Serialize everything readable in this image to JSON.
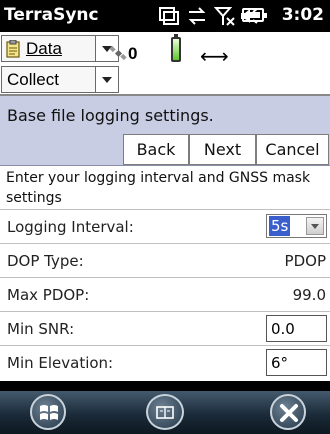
{
  "status_bar": {
    "app_title": "TerraSync",
    "time": "3:02",
    "icons": [
      "sync-icon",
      "connectivity-icon",
      "signal-off-icon",
      "volume-icon",
      "battery-icon"
    ]
  },
  "toolbar": {
    "data_menu_label": "Data",
    "collect_menu_label": "Collect",
    "satellite_count": "0",
    "arrows": "⟷"
  },
  "heading": {
    "title": "Base file logging settings.",
    "back_label": "Back",
    "next_label": "Next",
    "cancel_label": "Cancel"
  },
  "form": {
    "description": "Enter your logging interval and GNSS mask settings",
    "logging_interval": {
      "label": "Logging Interval:",
      "value": "5s"
    },
    "dop_type": {
      "label": "DOP Type:",
      "value": "PDOP"
    },
    "max_pdop": {
      "label": "Max PDOP:",
      "value": "99.0"
    },
    "min_snr": {
      "label": "Min SNR:",
      "value": "0.0"
    },
    "min_elevation": {
      "label": "Min Elevation:",
      "value": "6°"
    }
  },
  "taskbar": {
    "icons": [
      "windows-start-icon",
      "keyboard-icon",
      "close-icon"
    ]
  }
}
